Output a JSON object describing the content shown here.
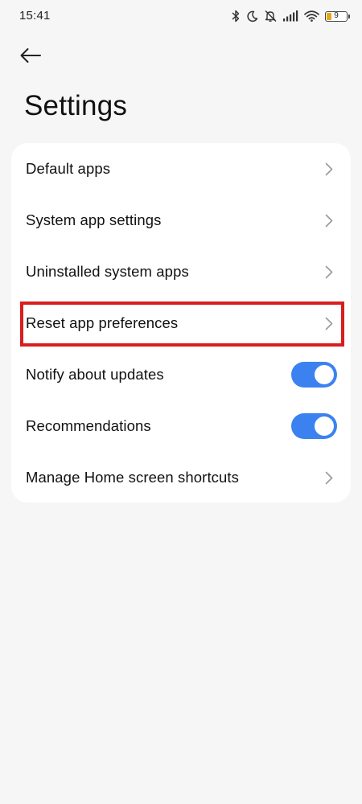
{
  "status_bar": {
    "time": "15:41",
    "battery_level": "9",
    "icons": [
      "bluetooth-icon",
      "moon-icon",
      "mute-icon",
      "signal-icon",
      "wifi-icon",
      "battery-icon"
    ]
  },
  "header": {
    "back_icon": "arrow-left-icon",
    "title": "Settings"
  },
  "settings": {
    "items": [
      {
        "label": "Default apps",
        "control": "chevron"
      },
      {
        "label": "System app settings",
        "control": "chevron"
      },
      {
        "label": "Uninstalled system apps",
        "control": "chevron"
      },
      {
        "label": "Reset app preferences",
        "control": "chevron",
        "highlighted": true
      },
      {
        "label": "Notify about updates",
        "control": "toggle",
        "on": true
      },
      {
        "label": "Recommendations",
        "control": "toggle",
        "on": true
      },
      {
        "label": "Manage Home screen shortcuts",
        "control": "chevron"
      }
    ]
  },
  "colors": {
    "background": "#f6f6f6",
    "card": "#ffffff",
    "toggle_on": "#3b82f0",
    "highlight_border": "#d81e1e",
    "chevron": "#9a9a9a"
  }
}
